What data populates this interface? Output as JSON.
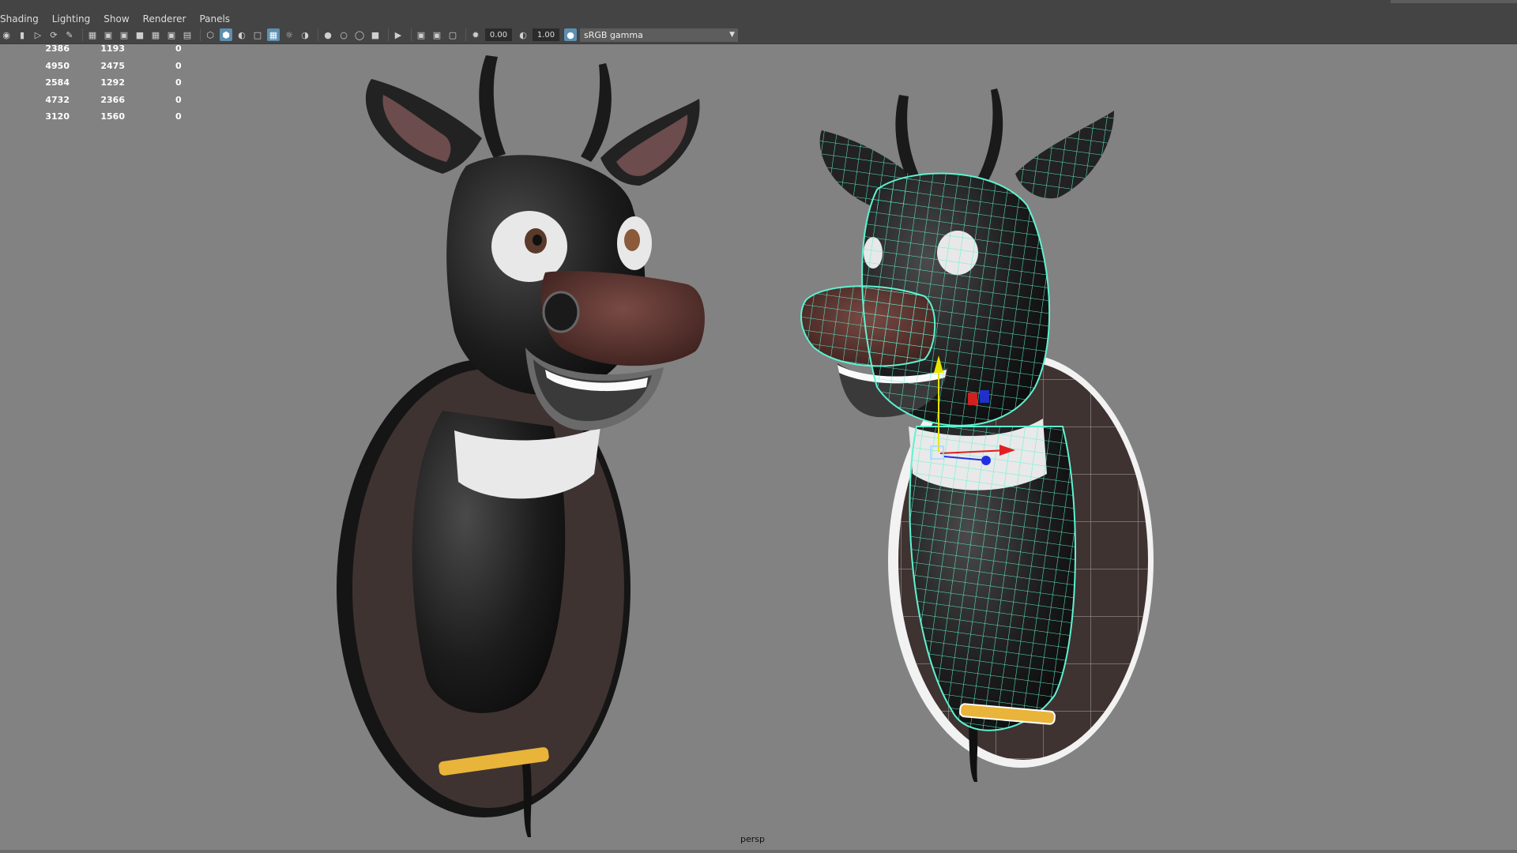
{
  "menu": [
    "Shading",
    "Lighting",
    "Show",
    "Renderer",
    "Panels"
  ],
  "toolbar": {
    "value_a": "0.00",
    "value_b": "1.00",
    "color_space": "sRGB gamma",
    "icons": [
      "camera-icon",
      "bookmark-icon",
      "image-plane-icon",
      "move-camera-icon",
      "paint-icon",
      "grid-icon",
      "film-gate-icon",
      "resolution-gate-icon",
      "gate-mask-icon",
      "field-chart-icon",
      "safe-action-icon",
      "safe-title-icon",
      "wireframe-icon",
      "smooth-shade-icon",
      "flat-shade-icon",
      "bounding-box-icon",
      "textured-icon",
      "lights-icon",
      "shadows-icon",
      "ambient-occlusion-icon",
      "motion-blur-icon",
      "anti-aliasing-icon",
      "depth-of-field-icon",
      "isolate-select-icon",
      "xray-icon",
      "xray-joints-icon",
      "xray-components-icon",
      "exposure-icon",
      "gamma-icon",
      "color-management-icon"
    ]
  },
  "stats": [
    [
      "2386",
      "1193",
      "0"
    ],
    [
      "4950",
      "2475",
      "0"
    ],
    [
      "2584",
      "1292",
      "0"
    ],
    [
      "4732",
      "2366",
      "0"
    ],
    [
      "3120",
      "1560",
      "0"
    ]
  ],
  "viewport": {
    "camera": "persp",
    "background": "#828282",
    "wire_color": "#5ff2d0"
  }
}
